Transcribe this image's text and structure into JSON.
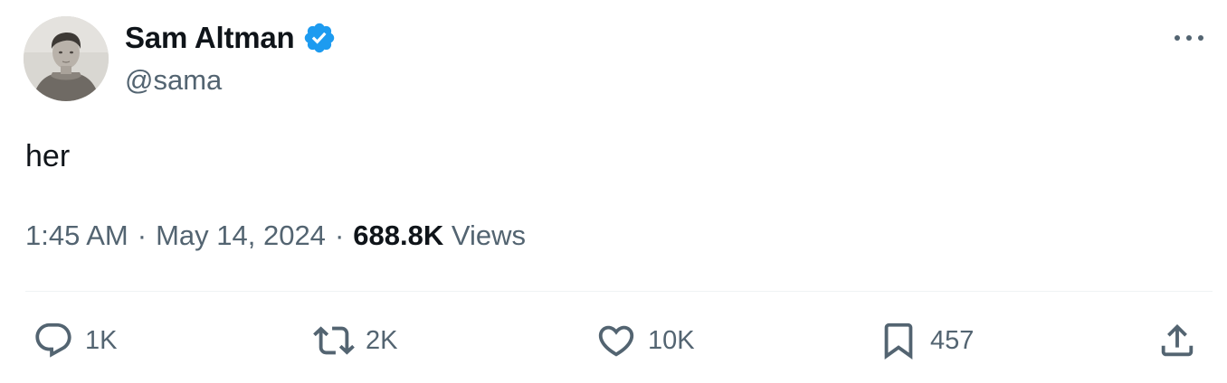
{
  "author": {
    "name": "Sam Altman",
    "handle": "@sama",
    "verified": true,
    "verified_color": "#1d9bf0"
  },
  "tweet": {
    "text": "her",
    "time": "1:45 AM",
    "separator": "·",
    "date": "May 14, 2024",
    "views_count": "688.8K",
    "views_label": "Views"
  },
  "actions": {
    "reply": {
      "icon": "reply-icon",
      "count": "1K"
    },
    "repost": {
      "icon": "repost-icon",
      "count": "2K"
    },
    "like": {
      "icon": "heart-icon",
      "count": "10K"
    },
    "bookmark": {
      "icon": "bookmark-icon",
      "count": "457"
    },
    "share": {
      "icon": "share-icon"
    }
  },
  "colors": {
    "text_primary": "#0f1419",
    "text_secondary": "#536471",
    "divider": "#eff3f4"
  }
}
